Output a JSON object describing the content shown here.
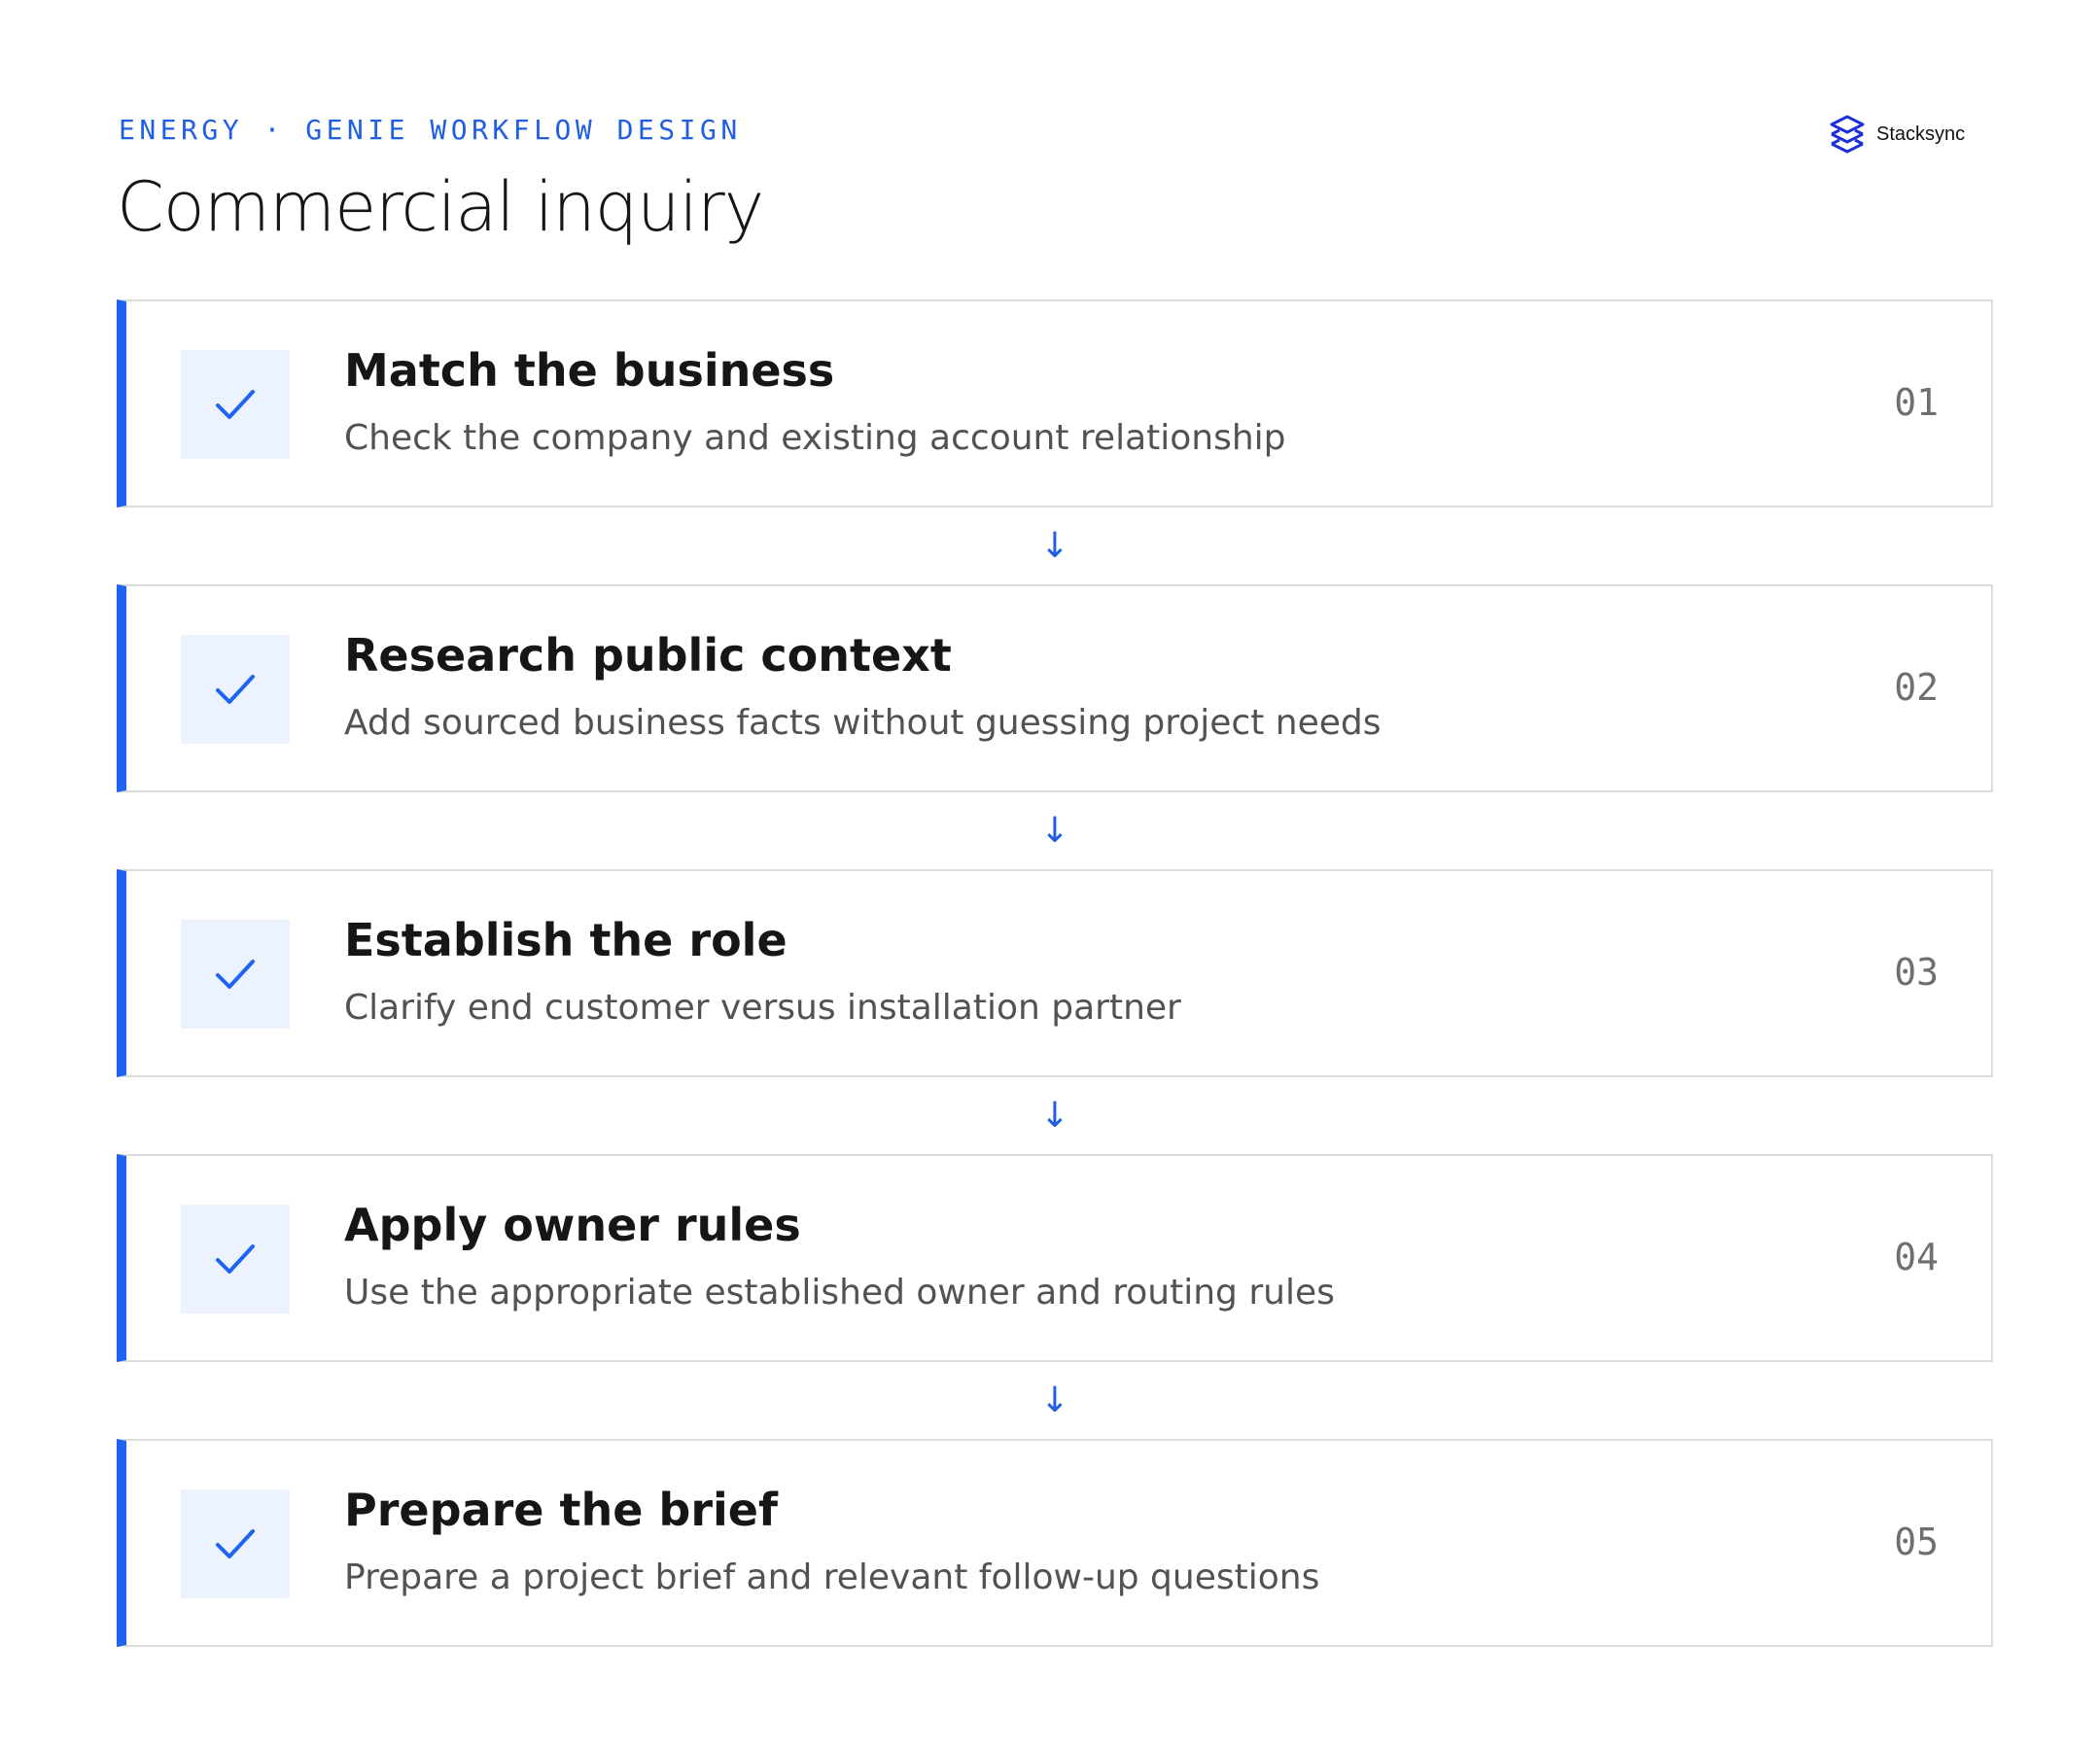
{
  "header": {
    "eyebrow": "ENERGY · GENIE WORKFLOW DESIGN",
    "title": "Commercial inquiry"
  },
  "brand": {
    "name": "Stacksync",
    "logo_icon": "stacked-layers-logo-icon"
  },
  "colors": {
    "accent": "#1f64f0",
    "eyebrow": "#1f5fe0",
    "check_bg": "#ecf3ff",
    "card_border": "#dcdcdc",
    "title_text": "#161616",
    "desc_text": "#525252",
    "number_text": "#6f6f6f"
  },
  "connector_glyph": "↓",
  "steps": [
    {
      "title": "Match the business",
      "description": "Check the company and existing account relationship",
      "number": "01",
      "status_icon": "checkmark-icon"
    },
    {
      "title": "Research public context",
      "description": "Add sourced business facts without guessing project needs",
      "number": "02",
      "status_icon": "checkmark-icon"
    },
    {
      "title": "Establish the role",
      "description": "Clarify end customer versus installation partner",
      "number": "03",
      "status_icon": "checkmark-icon"
    },
    {
      "title": "Apply owner rules",
      "description": "Use the appropriate established owner and routing rules",
      "number": "04",
      "status_icon": "checkmark-icon"
    },
    {
      "title": "Prepare the brief",
      "description": "Prepare a project brief and relevant follow-up questions",
      "number": "05",
      "status_icon": "checkmark-icon"
    }
  ]
}
